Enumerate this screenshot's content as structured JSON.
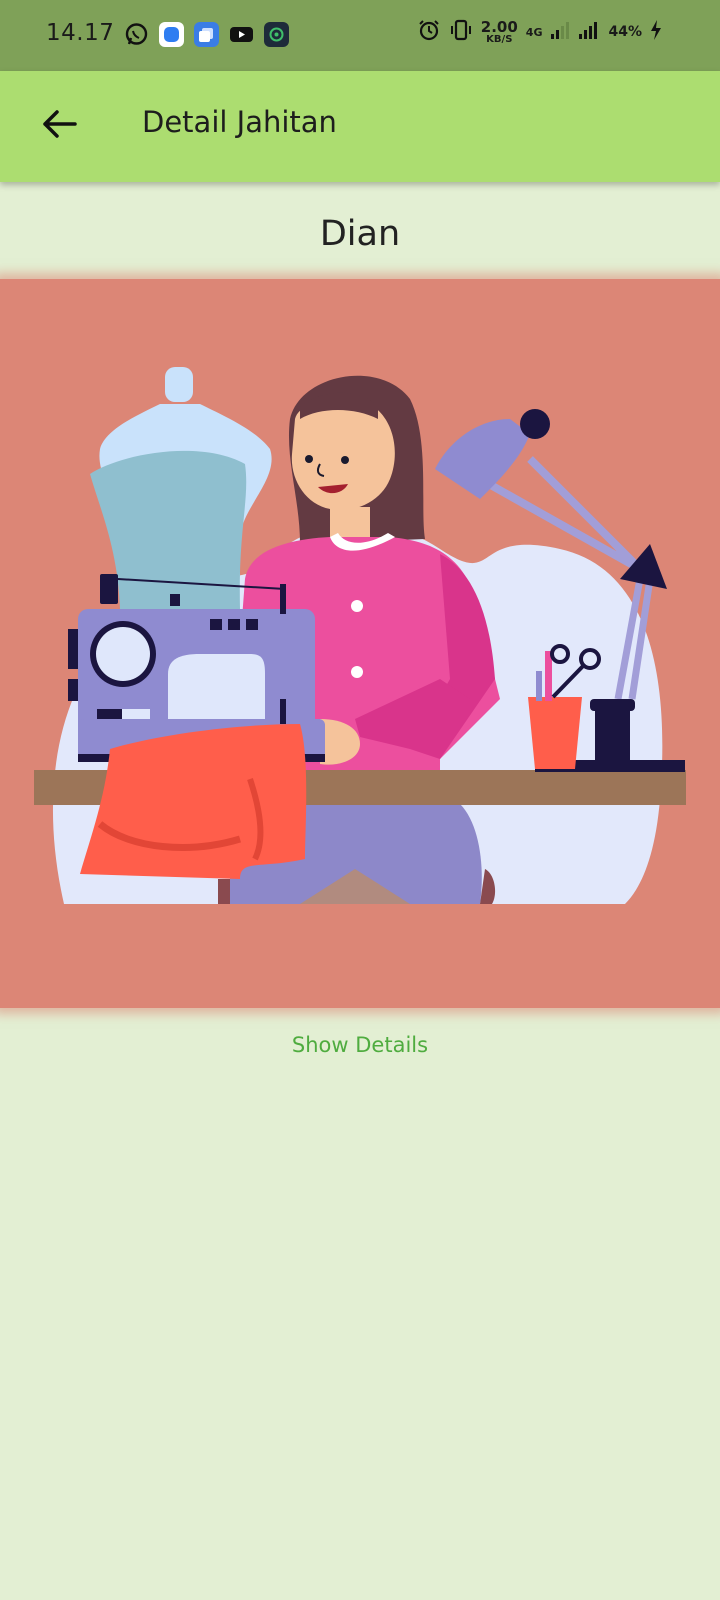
{
  "status_bar": {
    "time": "14.17",
    "net_speed_value": "2.00",
    "net_speed_unit": "KB/S",
    "network_type": "4G",
    "battery": "44%",
    "app_icons": [
      "whatsapp-icon",
      "app-blue-icon",
      "app-stack-icon",
      "youtube-icon",
      "app-green-icon"
    ]
  },
  "app_bar": {
    "title": "Detail Jahitan",
    "back_icon": "arrow-left-icon"
  },
  "detail": {
    "name": "Dian",
    "image_subject": "woman-sewing-illustration",
    "show_details_label": "Show Details"
  },
  "colors": {
    "status_bar": "#7fa158",
    "app_bar": "#acdd70",
    "background": "#e3efd3",
    "image_background": "#dc8676",
    "link": "#4fac3f"
  }
}
